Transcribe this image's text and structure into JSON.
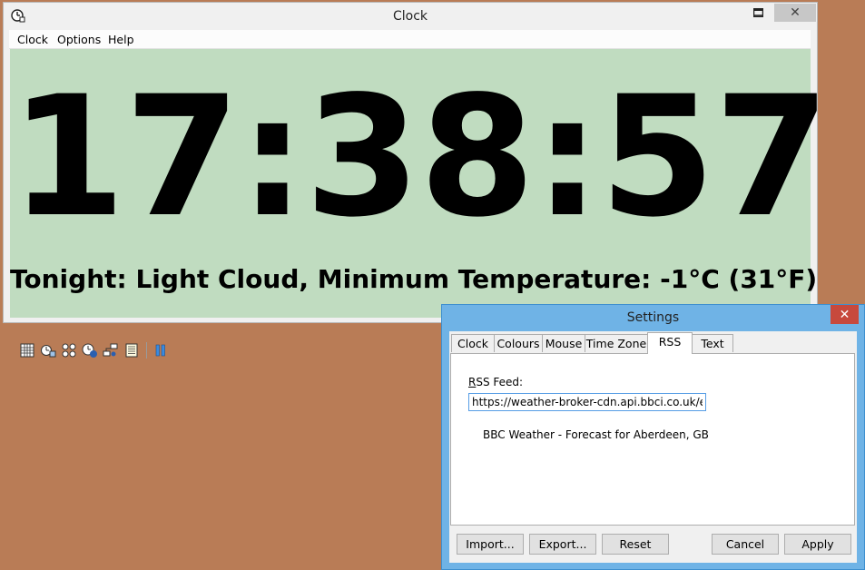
{
  "clock_window": {
    "title": "Clock",
    "menu": [
      "Clock",
      "Options",
      "Help"
    ],
    "time": "17:38:57",
    "rss_text": "Tonight: Light Cloud, Minimum Temperature: -1°C (31°F)",
    "background_color": "#c0dcc0",
    "toolbar_icons": [
      "calendar-icon",
      "alarm-icon",
      "timer-icon",
      "clock-icon",
      "network-icon",
      "notes-icon",
      "pause-icon"
    ]
  },
  "settings": {
    "title": "Settings",
    "tabs": [
      "Clock",
      "Colours",
      "Mouse",
      "Time Zone",
      "RSS",
      "Text"
    ],
    "active_tab": "RSS",
    "rss_label_accel": "R",
    "rss_label_rest": "SS Feed:",
    "rss_url": "https://weather-broker-cdn.api.bbci.co.uk/en/fc",
    "feed_title": "BBC Weather - Forecast for  Aberdeen, GB",
    "buttons": {
      "import": "Import...",
      "export": "Export...",
      "reset": "Reset",
      "cancel": "Cancel",
      "apply": "Apply"
    }
  }
}
